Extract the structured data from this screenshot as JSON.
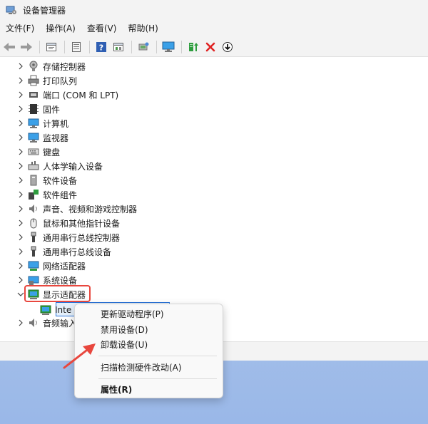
{
  "window": {
    "title": "设备管理器"
  },
  "menu": [
    {
      "label": "文件(F)"
    },
    {
      "label": "操作(A)"
    },
    {
      "label": "查看(V)"
    },
    {
      "label": "帮助(H)"
    }
  ],
  "toolbar": {
    "icons": [
      "back-arrow-icon",
      "forward-arrow-icon",
      "properties-icon",
      "view-icon",
      "help-icon",
      "console-icon",
      "scan-icon",
      "monitor-icon",
      "update-driver-icon",
      "uninstall-x-icon",
      "download-icon"
    ]
  },
  "tree": {
    "items": [
      {
        "label": "存储控制器",
        "icon": "storage-controller-icon"
      },
      {
        "label": "打印队列",
        "icon": "printer-icon"
      },
      {
        "label": "端口 (COM 和 LPT)",
        "icon": "port-icon"
      },
      {
        "label": "固件",
        "icon": "firmware-icon"
      },
      {
        "label": "计算机",
        "icon": "computer-icon"
      },
      {
        "label": "监视器",
        "icon": "monitor-icon"
      },
      {
        "label": "键盘",
        "icon": "keyboard-icon"
      },
      {
        "label": "人体学输入设备",
        "icon": "hid-icon"
      },
      {
        "label": "软件设备",
        "icon": "software-device-icon"
      },
      {
        "label": "软件组件",
        "icon": "software-component-icon"
      },
      {
        "label": "声音、视频和游戏控制器",
        "icon": "speaker-icon"
      },
      {
        "label": "鼠标和其他指针设备",
        "icon": "mouse-icon"
      },
      {
        "label": "通用串行总线控制器",
        "icon": "usb-icon"
      },
      {
        "label": "通用串行总线设备",
        "icon": "usb-icon"
      },
      {
        "label": "网络适配器",
        "icon": "network-adapter-icon"
      },
      {
        "label": "系统设备",
        "icon": "system-device-icon"
      },
      {
        "label": "显示适配器",
        "icon": "display-adapter-icon"
      }
    ],
    "child": {
      "label": "Inte"
    },
    "after": {
      "label": "音频输入"
    }
  },
  "context_menu": {
    "items": [
      {
        "label": "更新驱动程序(P)"
      },
      {
        "label": "禁用设备(D)"
      },
      {
        "label": "卸载设备(U)"
      },
      {
        "label": "扫描检测硬件改动(A)"
      },
      {
        "label": "属性(R)"
      }
    ]
  },
  "colors": {
    "highlight": "#e8473e",
    "selection": "#2b74d9",
    "accent_green": "#2e9d3e",
    "monitor_blue": "#3aa0e8"
  }
}
